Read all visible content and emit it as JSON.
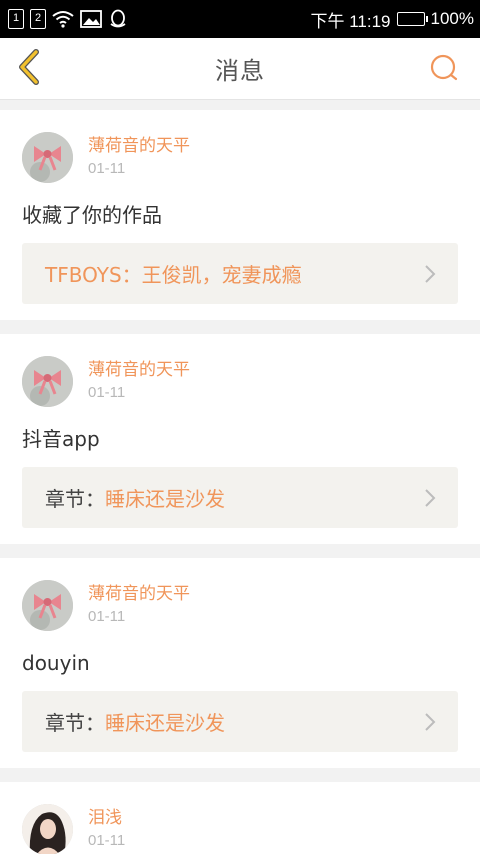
{
  "status_bar": {
    "sim1": "1",
    "sim2": "2",
    "time": "下午 11:19",
    "battery": "100%",
    "battery_level": 1.0
  },
  "header": {
    "title": "消息",
    "back_icon": "chevron-left-icon",
    "search_icon": "search-icon"
  },
  "colors": {
    "accent": "#f0955a",
    "back_accent": "#f2c12e"
  },
  "messages": [
    {
      "username": "薄荷音的天平",
      "date": "01-11",
      "text": "收藏了你的作品",
      "link_prefix": "",
      "link_title": "TFBOYS：王俊凯，宠妻成瘾"
    },
    {
      "username": "薄荷音的天平",
      "date": "01-11",
      "text": "抖音app",
      "link_prefix": "章节：",
      "link_title": "睡床还是沙发"
    },
    {
      "username": "薄荷音的天平",
      "date": "01-11",
      "text": "douyin",
      "link_prefix": "章节：",
      "link_title": "睡床还是沙发"
    },
    {
      "username": "泪浅",
      "date": "01-11"
    }
  ]
}
